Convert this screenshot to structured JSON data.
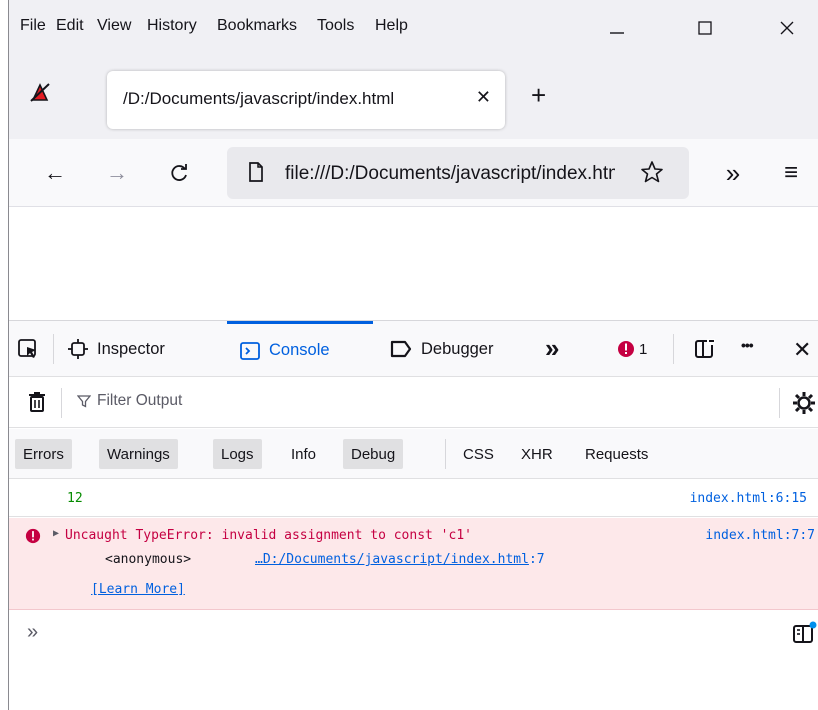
{
  "menu": {
    "items": [
      {
        "label": "File"
      },
      {
        "label": "Edit"
      },
      {
        "label": "View"
      },
      {
        "label": "History"
      },
      {
        "label": "Bookmarks"
      },
      {
        "label": "Tools"
      },
      {
        "label": "Help"
      }
    ]
  },
  "window_controls": {
    "minimize": "—",
    "maximize": "☐",
    "close": "✕"
  },
  "tab": {
    "title": "/D:/Documents/javascript/index.html",
    "close": "✕",
    "new_tab": "+"
  },
  "nav": {
    "back": "←",
    "forward": "→",
    "reload": "C",
    "url": "file:///D:/Documents/javascript/index.html",
    "overflow": "»",
    "menu": "≡"
  },
  "devtools": {
    "tabs": [
      {
        "label": "Inspector"
      },
      {
        "label": "Console",
        "selected": true
      },
      {
        "label": "Debugger"
      }
    ],
    "more_tabs": "»",
    "error_count": "1",
    "more_menu": "•••",
    "close": "✕",
    "filter_placeholder": "Filter Output",
    "levels": [
      {
        "label": "Errors",
        "active": true
      },
      {
        "label": "Warnings",
        "active": true
      },
      {
        "label": "Logs",
        "active": true
      },
      {
        "label": "Info",
        "active": false
      },
      {
        "label": "Debug",
        "active": true
      }
    ],
    "categories": [
      "CSS",
      "XHR",
      "Requests"
    ],
    "messages": [
      {
        "type": "log",
        "value": "12",
        "location_file": "index.html",
        "location_pos": ":6:15"
      },
      {
        "type": "error",
        "expander": "▶",
        "text": "Uncaught TypeError: invalid assignment to const 'c1'",
        "location_file": "index.html",
        "location_pos": ":7:7",
        "stack_fn": "<anonymous>",
        "stack_loc": "…D:/Documents/javascript/index.html",
        "stack_pos": ":7",
        "learn_more": "[Learn More]"
      }
    ],
    "prompt": "»"
  },
  "colors": {
    "accent": "#0060df",
    "error_bg": "#fde8ea",
    "error_text": "#c50042",
    "number_green": "#058b00"
  }
}
